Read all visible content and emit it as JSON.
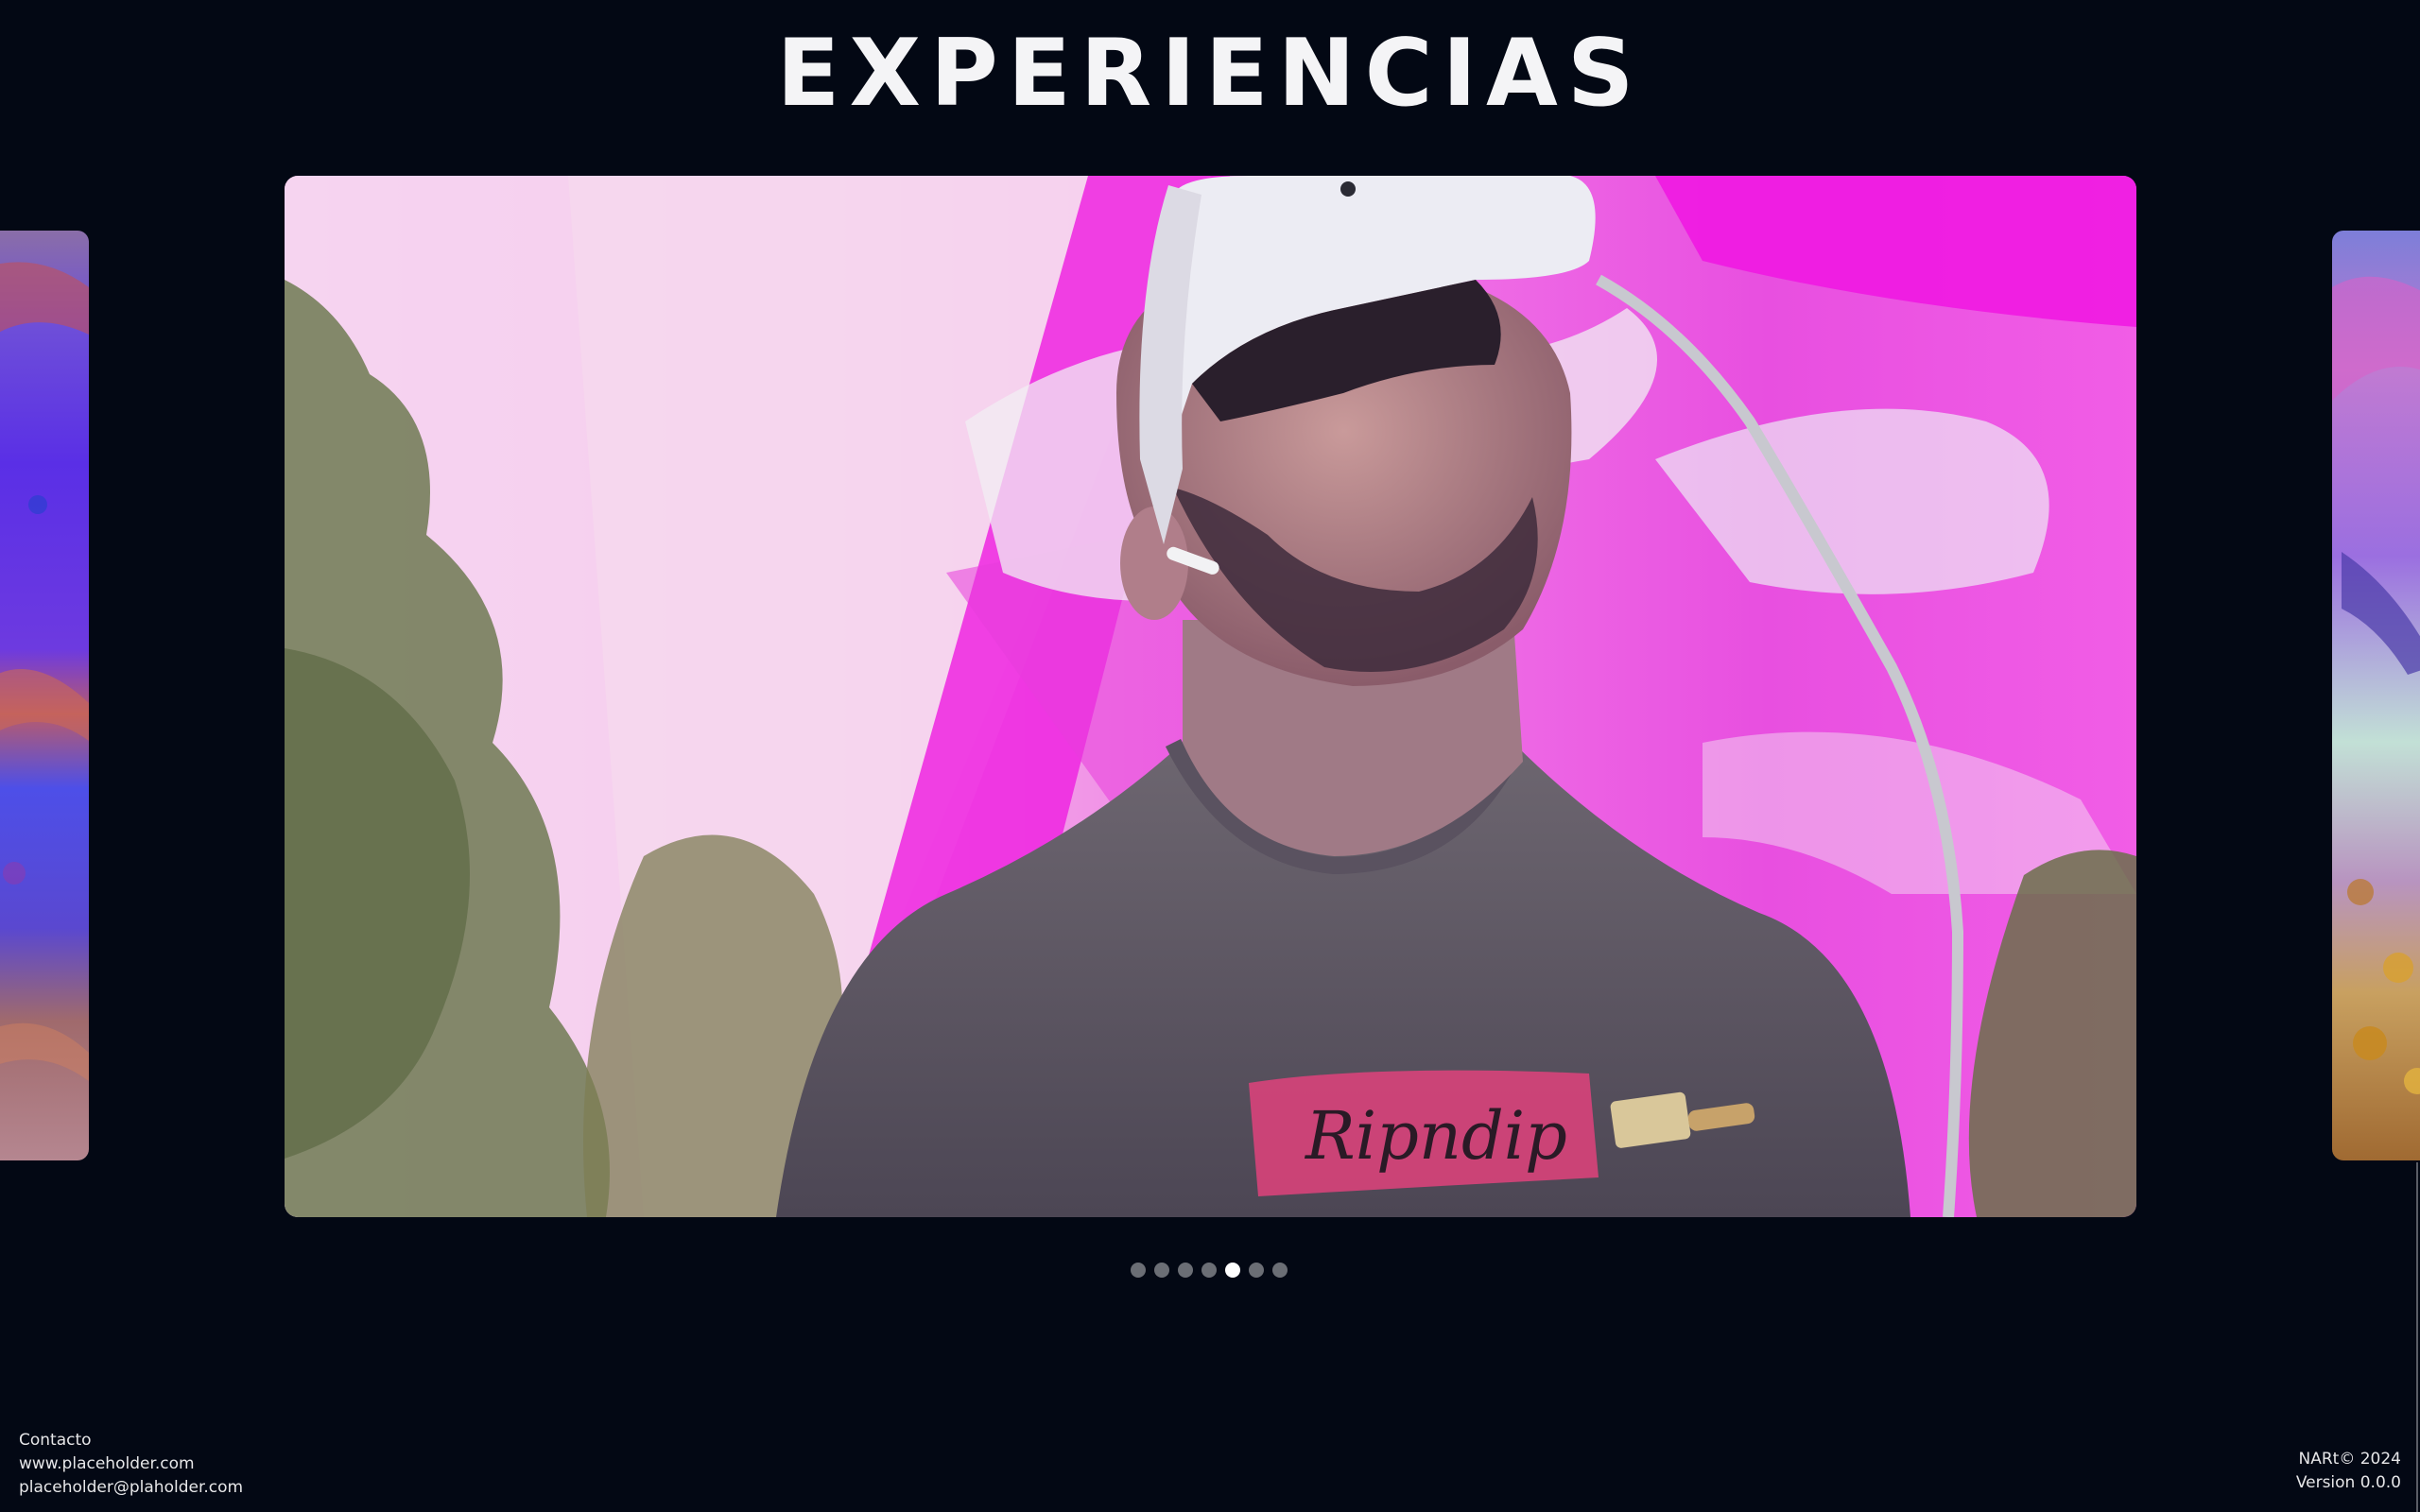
{
  "page": {
    "title": "EXPERIENCIAS"
  },
  "carousel": {
    "slide_count": 7,
    "active_index": 4,
    "current_slide_alt": "Persona con visor de realidad virtual",
    "current_tshirt_text": "Ripndip"
  },
  "footer": {
    "contact_heading": "Contacto",
    "website": "www.placeholder.com",
    "email": "placeholder@plaholder.com",
    "copyright": "NARt© 2024",
    "version": "Version 0.0.0"
  },
  "colors": {
    "background": "#030814",
    "dot_inactive": "#6b6e75",
    "dot_active": "#ffffff"
  }
}
